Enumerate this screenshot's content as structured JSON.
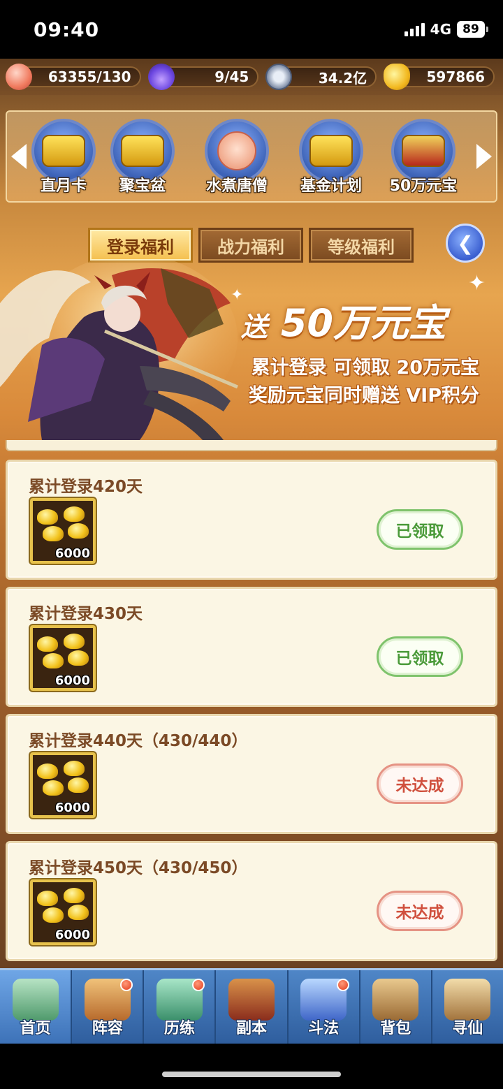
{
  "status_bar": {
    "time": "09:40",
    "network": "4G",
    "battery": "89"
  },
  "resources": [
    {
      "icon": "peach-icon",
      "value": "63355/130"
    },
    {
      "icon": "spirit-fire-icon",
      "value": "9/45"
    },
    {
      "icon": "copper-coin-icon",
      "value": "34.2亿"
    },
    {
      "icon": "gold-ingot-icon",
      "value": "597866"
    }
  ],
  "features": [
    {
      "label": "直月卡",
      "icon": "month-card-icon"
    },
    {
      "label": "聚宝盆",
      "icon": "treasure-bowl-icon"
    },
    {
      "label": "水煮唐僧",
      "icon": "tang-monk-icon"
    },
    {
      "label": "基金计划",
      "icon": "fund-plan-icon"
    },
    {
      "label": "50万元宝",
      "icon": "treasure-chest-icon"
    }
  ],
  "tabs": [
    {
      "label": "登录福利",
      "active": true
    },
    {
      "label": "战力福利",
      "active": false
    },
    {
      "label": "等级福利",
      "active": false
    }
  ],
  "banner": {
    "title_prefix": "送",
    "title_main": "50万元宝",
    "line1": "累计登录 可领取 20万元宝",
    "line2": "奖励元宝同时赠送 VIP积分"
  },
  "rewards": [
    {
      "title": "累计登录420天",
      "qty": "6000",
      "status": "已领取",
      "state": "claimed"
    },
    {
      "title": "累计登录430天",
      "qty": "6000",
      "status": "已领取",
      "state": "claimed"
    },
    {
      "title": "累计登录440天（430/440）",
      "qty": "6000",
      "status": "未达成",
      "state": "unmet"
    },
    {
      "title": "累计登录450天（430/450）",
      "qty": "6000",
      "status": "未达成",
      "state": "unmet"
    }
  ],
  "bottom_nav": [
    {
      "label": "首页",
      "badge": false
    },
    {
      "label": "阵容",
      "badge": true
    },
    {
      "label": "历练",
      "badge": true
    },
    {
      "label": "副本",
      "badge": false
    },
    {
      "label": "斗法",
      "badge": true
    },
    {
      "label": "背包",
      "badge": false
    },
    {
      "label": "寻仙",
      "badge": false
    }
  ],
  "colors": {
    "claimed": "#4a9a39",
    "unmet": "#d0503e",
    "nav": "#2f5e9e"
  }
}
